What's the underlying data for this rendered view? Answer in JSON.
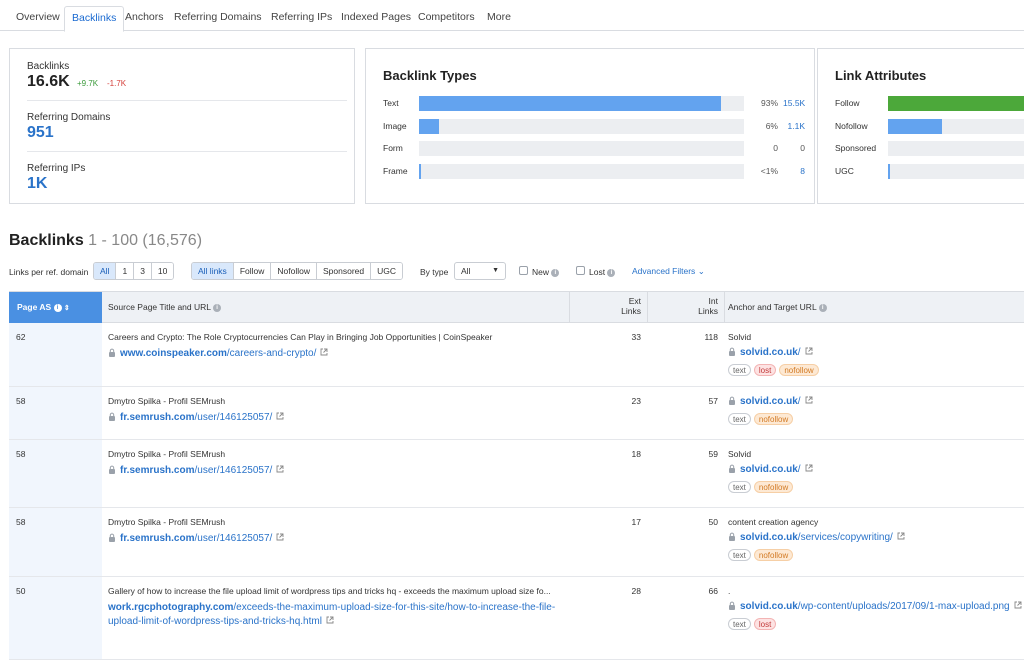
{
  "tabs": [
    "Overview",
    "Backlinks",
    "Anchors",
    "Referring Domains",
    "Referring IPs",
    "Indexed Pages",
    "Competitors",
    "More"
  ],
  "summary": {
    "backlinks_label": "Backlinks",
    "backlinks_value": "16.6K",
    "backlinks_up": "+9.7K",
    "backlinks_down": "-1.7K",
    "domains_label": "Referring Domains",
    "domains_value": "951",
    "ips_label": "Referring IPs",
    "ips_value": "1K"
  },
  "types": {
    "title": "Backlink Types",
    "rows": [
      {
        "label": "Text",
        "pct": "93%",
        "count": "15.5K",
        "fill": 0.93
      },
      {
        "label": "Image",
        "pct": "6%",
        "count": "1.1K",
        "fill": 0.06
      },
      {
        "label": "Form",
        "pct": "0",
        "count": "0",
        "fill": 0
      },
      {
        "label": "Frame",
        "pct": "<1%",
        "count": "8",
        "fill": 0.004
      }
    ]
  },
  "attributes": {
    "title": "Link Attributes",
    "rows": [
      {
        "label": "Follow",
        "fill": 1.0,
        "color": "#4ca83a"
      },
      {
        "label": "Nofollow",
        "fill": 0.36,
        "color": "#63a3ef"
      },
      {
        "label": "Sponsored",
        "fill": 0,
        "color": "#63a3ef"
      },
      {
        "label": "UGC",
        "fill": 0.01,
        "color": "#63a3ef"
      }
    ]
  },
  "backlinks": {
    "title": "Backlinks",
    "range": "1 - 100 (16,576)",
    "links_per_label": "Links per ref. domain",
    "links_per_options": [
      "All",
      "1",
      "3",
      "10"
    ],
    "type_filters": [
      "All links",
      "Follow",
      "Nofollow",
      "Sponsored",
      "UGC"
    ],
    "by_type_label": "By type",
    "by_type_value": "All",
    "new_label": "New",
    "lost_label": "Lost",
    "advanced_label": "Advanced Filters"
  },
  "table": {
    "col_page_as": "Page AS",
    "col_source": "Source Page Title and URL",
    "col_ext_1": "Ext",
    "col_ext_2": "Links",
    "col_int_1": "Int",
    "col_int_2": "Links",
    "col_anchor": "Anchor and Target URL",
    "rows": [
      {
        "page_as": "62",
        "title": "Careers and Crypto: The Role Cryptocurrencies Can Play in Bringing Job Opportunities | CoinSpeaker",
        "src_domain": "www.coinspeaker.com",
        "src_path": "/careers-and-crypto/",
        "src_path2": "",
        "ext": "33",
        "int": "118",
        "anchor": "Solvid",
        "tgt_domain": "solvid.co.uk",
        "tgt_path": "/",
        "tags": [
          "text",
          "lost",
          "nofollow"
        ]
      },
      {
        "page_as": "58",
        "title": "Dmytro Spilka - Profil SEMrush",
        "src_domain": "fr.semrush.com",
        "src_path": "/user/146125057/",
        "src_path2": "",
        "ext": "23",
        "int": "57",
        "anchor": "",
        "tgt_domain": "solvid.co.uk",
        "tgt_path": "/",
        "tags": [
          "text",
          "nofollow"
        ]
      },
      {
        "page_as": "58",
        "title": "Dmytro Spilka - Profil SEMrush",
        "src_domain": "fr.semrush.com",
        "src_path": "/user/146125057/",
        "src_path2": "",
        "ext": "18",
        "int": "59",
        "anchor": "Solvid",
        "tgt_domain": "solvid.co.uk",
        "tgt_path": "/",
        "tags": [
          "text",
          "nofollow"
        ]
      },
      {
        "page_as": "58",
        "title": "Dmytro Spilka - Profil SEMrush",
        "src_domain": "fr.semrush.com",
        "src_path": "/user/146125057/",
        "src_path2": "",
        "ext": "17",
        "int": "50",
        "anchor": "content creation agency",
        "tgt_domain": "solvid.co.uk",
        "tgt_path": "/services/copywriting/",
        "tags": [
          "text",
          "nofollow"
        ]
      },
      {
        "page_as": "50",
        "title": "Gallery of how to increase the file upload limit of wordpress tips and tricks hq - exceeds the maximum upload size fo...",
        "src_domain": "work.rgcphotography.com",
        "src_path": "/exceeds-the-maximum-upload-size-for-this-site/how-to-increase-the-file-",
        "src_path2": "upload-limit-of-wordpress-tips-and-tricks-hq.html",
        "ext": "28",
        "int": "66",
        "anchor": ".",
        "tgt_domain": "solvid.co.uk",
        "tgt_path": "/wp-content/uploads/2017/09/1-max-upload.png",
        "tags": [
          "text",
          "lost"
        ]
      }
    ]
  }
}
